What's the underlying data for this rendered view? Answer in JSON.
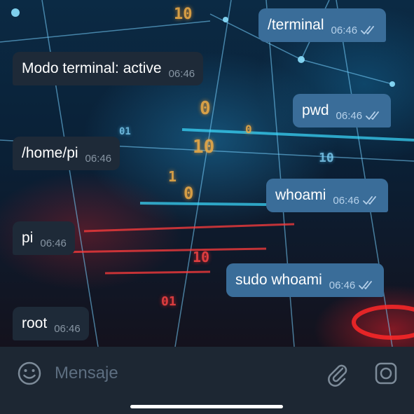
{
  "messages": [
    {
      "direction": "out",
      "text": "/terminal",
      "time": "06:46",
      "read": true
    },
    {
      "direction": "in",
      "text": "Modo terminal: active",
      "time": "06:46"
    },
    {
      "direction": "out",
      "text": "pwd",
      "time": "06:46",
      "read": true
    },
    {
      "direction": "in",
      "text": "/home/pi",
      "time": "06:46"
    },
    {
      "direction": "out",
      "text": "whoami",
      "time": "06:46",
      "read": true
    },
    {
      "direction": "in",
      "text": "pi",
      "time": "06:46"
    },
    {
      "direction": "out",
      "text": "sudo whoami",
      "time": "06:46",
      "read": true
    },
    {
      "direction": "in",
      "text": "root",
      "time": "06:46"
    }
  ],
  "composer": {
    "placeholder": "Mensaje",
    "emoji_icon": "emoji-icon",
    "attach_icon": "paperclip-icon",
    "camera_icon": "camera-icon"
  },
  "colors": {
    "incoming_bubble": "#1e2a38",
    "outgoing_bubble": "#3a6d99",
    "input_bar": "#1d2733",
    "read_ticks": "#b6d1ea"
  }
}
